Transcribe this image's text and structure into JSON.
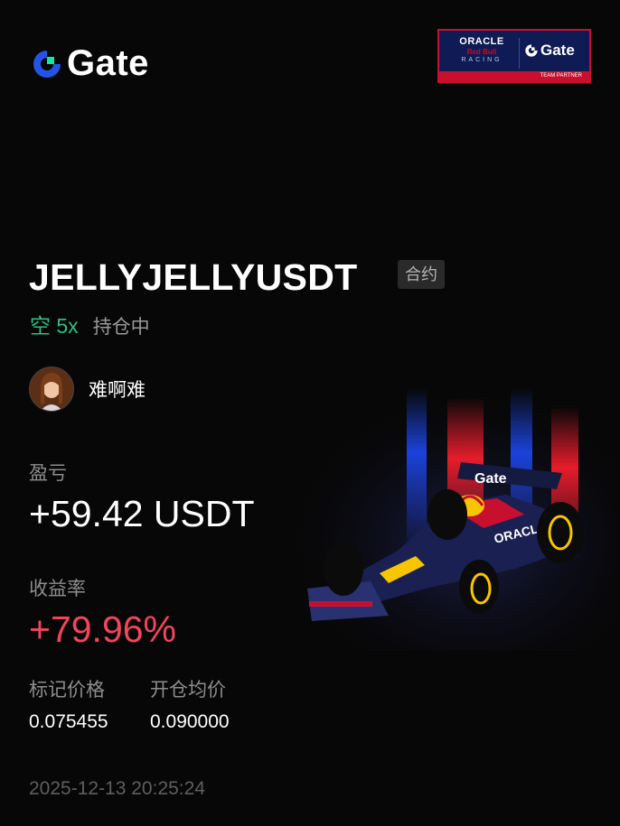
{
  "brand": {
    "name": "Gate",
    "accent": "#2354e6",
    "green": "#17e6a1"
  },
  "partner": {
    "oracle": "ORACLE",
    "redbull": "Red Bull",
    "racing": "RACING",
    "gate": "Gate",
    "strip": "TEAM PARTNER"
  },
  "position": {
    "pair": "JELLYJELLYUSDT",
    "tag": "合约",
    "side": "空 5x",
    "status": "持仓中"
  },
  "user": {
    "name": "难啊难"
  },
  "pnl": {
    "label": "盈亏",
    "value": "+59.42 USDT"
  },
  "roi": {
    "label": "收益率",
    "value": "+79.96%",
    "color": "#f2455c"
  },
  "mark_price": {
    "label": "标记价格",
    "value": "0.075455"
  },
  "entry_price": {
    "label": "开仓均价",
    "value": "0.090000"
  },
  "timestamp": "2025-12-13 20:25:24",
  "car": {
    "livery": "Gate"
  }
}
